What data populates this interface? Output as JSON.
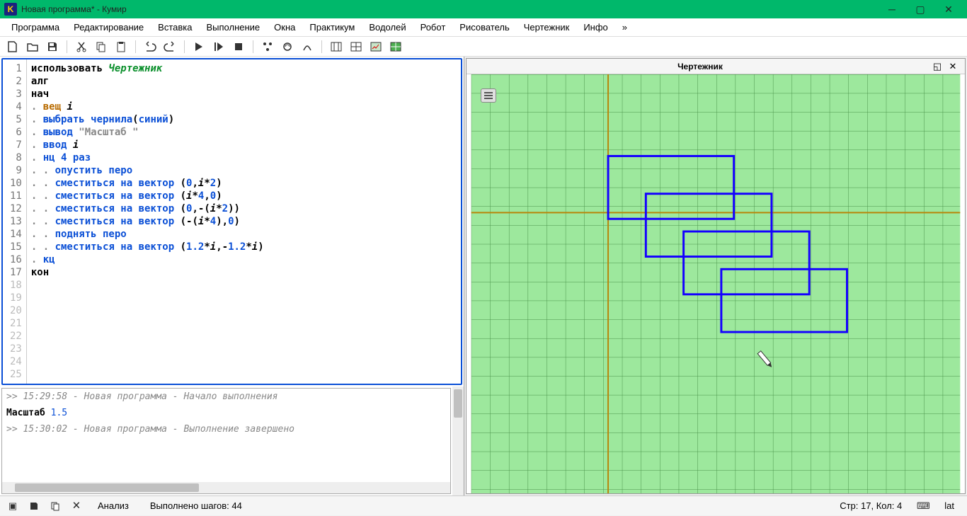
{
  "titlebar": {
    "app_letter": "K",
    "title": "Новая программа* - Кумир"
  },
  "menu": {
    "program": "Программа",
    "edit": "Редактирование",
    "insert": "Вставка",
    "run": "Выполнение",
    "windows": "Окна",
    "practicum": "Практикум",
    "vodoley": "Водолей",
    "robot": "Робот",
    "painter": "Рисователь",
    "drawer": "Чертежник",
    "info": "Инфо",
    "more": "»"
  },
  "code": {
    "lines": [
      {
        "n": "1",
        "t": "использовать ",
        "g": "Чертежник"
      },
      {
        "n": "2",
        "t": "алг"
      },
      {
        "n": "3",
        "t": "нач"
      },
      {
        "n": "4",
        "d": ". ",
        "o": "вещ ",
        "i": "i"
      },
      {
        "n": "5",
        "d": ". ",
        "b": "выбрать чернила",
        "p": "(",
        "b2": "синий",
        "p2": ")"
      },
      {
        "n": "6",
        "d": ". ",
        "b": "вывод ",
        "s": "\"Масштаб \""
      },
      {
        "n": "7",
        "d": ". ",
        "b": "ввод ",
        "i": "i"
      },
      {
        "n": "8",
        "d": ". ",
        "b": "нц ",
        "n2": "4",
        "b2": " раз"
      },
      {
        "n": "9",
        "d": ". . ",
        "b": "опустить перо"
      },
      {
        "n": "10",
        "d": ". . ",
        "b": "сместиться на вектор ",
        "p": "(",
        "n2": "0",
        "c": ",",
        "i": "i",
        "m": "*",
        "n3": "2",
        "p2": ")"
      },
      {
        "n": "11",
        "d": ". . ",
        "b": "сместиться на вектор ",
        "p": "(",
        "i": "i",
        "m": "*",
        "n2": "4",
        "c": ",",
        "n3": "0",
        "p2": ")"
      },
      {
        "n": "12",
        "d": ". . ",
        "b": "сместиться на вектор ",
        "p": "(",
        "n2": "0",
        "c": ",-(",
        "i": "i",
        "m": "*",
        "n3": "2",
        "p2": "))"
      },
      {
        "n": "13",
        "d": ". . ",
        "b": "сместиться на вектор ",
        "p": "(-(",
        "i": "i",
        "m": "*",
        "n2": "4",
        "c": "),",
        "n3": "0",
        "p2": ")"
      },
      {
        "n": "14",
        "d": ". . ",
        "b": "поднять перо"
      },
      {
        "n": "15",
        "d": ". . ",
        "b": "сместиться на вектор ",
        "p": "(",
        "n2": "1.2",
        "m": "*",
        "i": "i",
        "c": ",",
        "neg": "-",
        "n3": "1.2",
        "m2": "*",
        "i2": "i",
        "p2": ")"
      },
      {
        "n": "16",
        "d": ". ",
        "b": "кц"
      },
      {
        "n": "17",
        "t": "кон"
      }
    ],
    "empty": [
      "18",
      "19",
      "20",
      "21",
      "22",
      "23",
      "24",
      "25"
    ]
  },
  "console": {
    "log1": ">> 15:29:58 - Новая программа - Начало выполнения",
    "out_label": "Масштаб ",
    "out_val": "1.5",
    "log2": ">> 15:30:02 - Новая программа - Выполнение завершено"
  },
  "canvas": {
    "title": "Чертежник"
  },
  "status": {
    "analysis": "Анализ",
    "steps": "Выполнено шагов: 44",
    "pos": "Стр: 17, Кол: 4",
    "lang": "lat"
  }
}
